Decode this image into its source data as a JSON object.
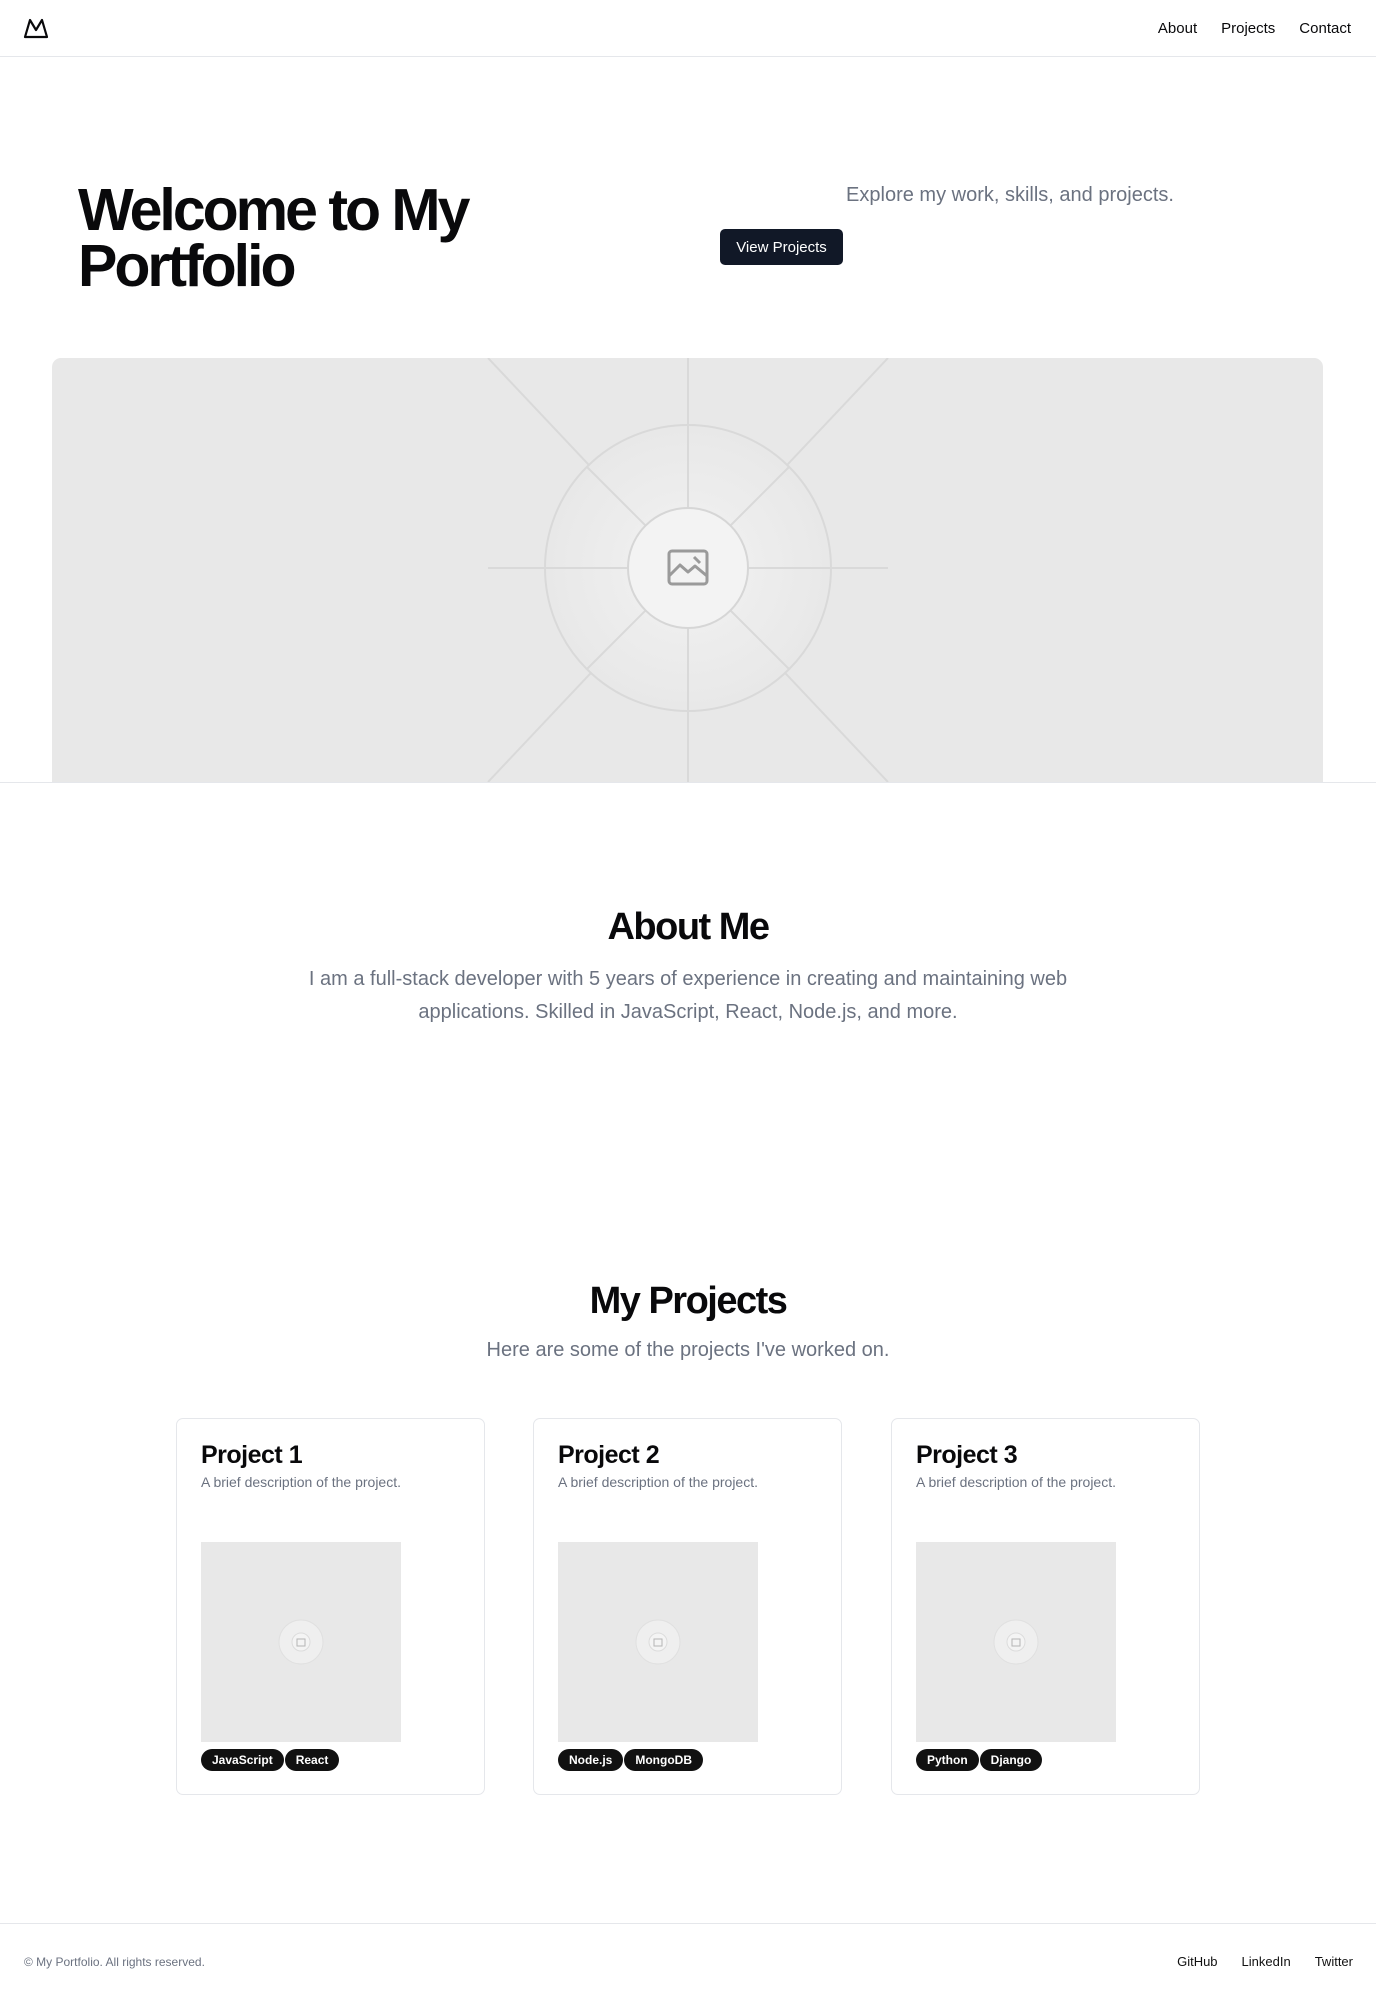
{
  "header": {
    "nav": [
      "About",
      "Projects",
      "Contact"
    ]
  },
  "hero": {
    "title": "Welcome to My Portfolio",
    "subtitle": "Explore my work, skills, and projects.",
    "button_label": "View Projects"
  },
  "about": {
    "title": "About Me",
    "text": "I am a full-stack developer with 5 years of experience in creating and maintaining web applications. Skilled in JavaScript, React, Node.js, and more."
  },
  "projects": {
    "title": "My Projects",
    "subtitle": "Here are some of the projects I've worked on.",
    "items": [
      {
        "title": "Project 1",
        "description": "A brief description of the project.",
        "tags": [
          "JavaScript",
          "React"
        ]
      },
      {
        "title": "Project 2",
        "description": "A brief description of the project.",
        "tags": [
          "Node.js",
          "MongoDB"
        ]
      },
      {
        "title": "Project 3",
        "description": "A brief description of the project.",
        "tags": [
          "Python",
          "Django"
        ]
      }
    ]
  },
  "footer": {
    "copyright": "© My Portfolio. All rights reserved.",
    "links": [
      "GitHub",
      "LinkedIn",
      "Twitter"
    ]
  },
  "icons": {
    "logo": "mountain-logo-icon",
    "placeholder": "image-placeholder-icon"
  }
}
